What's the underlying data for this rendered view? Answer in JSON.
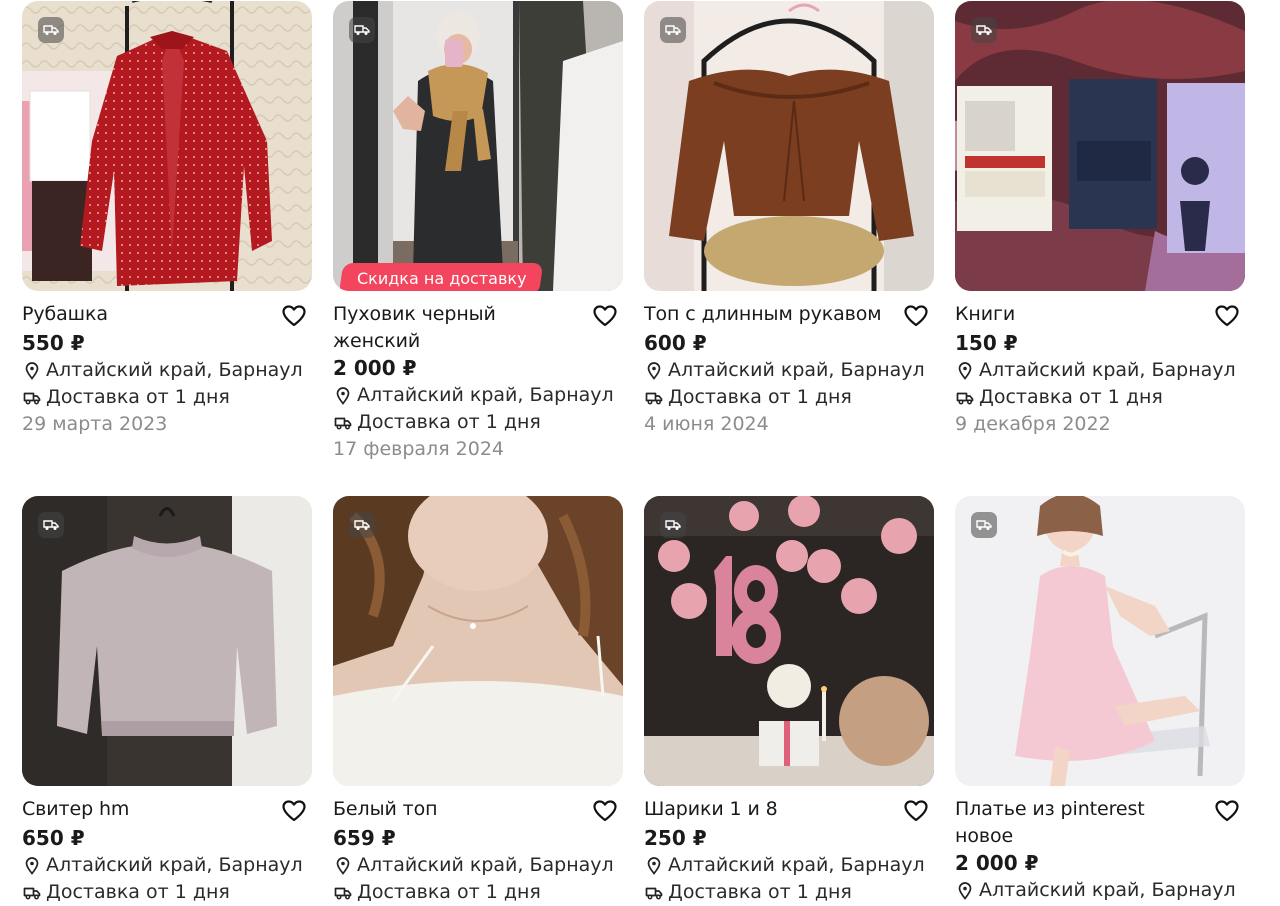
{
  "currency": "₽",
  "colors": {
    "text": "#1a1a1a",
    "muted": "#8c8c8c",
    "promo": "#f3455d"
  },
  "icons": {
    "delivery": "truck-icon",
    "favorite": "heart-outline-icon",
    "location": "map-pin-icon"
  },
  "listings": [
    {
      "title": "Рубашка",
      "price": "550 ₽",
      "location": "Алтайский край, Барнаул",
      "delivery": "Доставка от 1 дня",
      "date": "29 марта 2023",
      "promo": ""
    },
    {
      "title": "Пуховик черный женский",
      "price": "2 000 ₽",
      "location": "Алтайский край, Барнаул",
      "delivery": "Доставка от 1 дня",
      "date": "17 февраля 2024",
      "promo": "Скидка на доставку"
    },
    {
      "title": "Топ с длинным рукавом",
      "price": "600 ₽",
      "location": "Алтайский край, Барнаул",
      "delivery": "Доставка от 1 дня",
      "date": "4 июня 2024",
      "promo": ""
    },
    {
      "title": "Книги",
      "price": "150 ₽",
      "location": "Алтайский край, Барнаул",
      "delivery": "Доставка от 1 дня",
      "date": "9 декабря 2022",
      "promo": ""
    },
    {
      "title": "Свитер hm",
      "price": "650 ₽",
      "location": "Алтайский край, Барнаул",
      "delivery": "Доставка от 1 дня",
      "date": "",
      "promo": ""
    },
    {
      "title": "Белый топ",
      "price": "659 ₽",
      "location": "Алтайский край, Барнаул",
      "delivery": "Доставка от 1 дня",
      "date": "",
      "promo": ""
    },
    {
      "title": "Шарики 1 и 8",
      "price": "250 ₽",
      "location": "Алтайский край, Барнаул",
      "delivery": "Доставка от 1 дня",
      "date": "",
      "promo": ""
    },
    {
      "title": "Платье из pinterest новое",
      "price": "2 000 ₽",
      "location": "Алтайский край, Барнаул",
      "delivery": "",
      "date": "",
      "promo": ""
    }
  ]
}
